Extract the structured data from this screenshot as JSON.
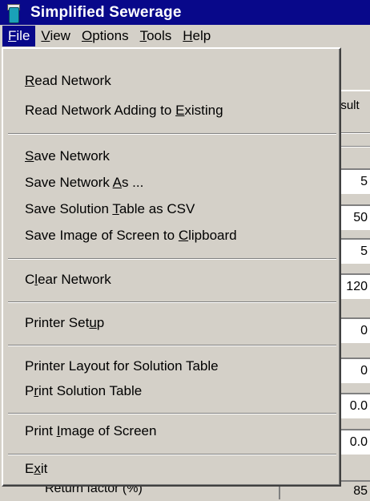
{
  "window": {
    "title": "Simplified Sewerage"
  },
  "menubar": {
    "items": [
      {
        "pre": "",
        "u": "F",
        "post": "ile"
      },
      {
        "pre": "",
        "u": "V",
        "post": "iew"
      },
      {
        "pre": "",
        "u": "O",
        "post": "ptions"
      },
      {
        "pre": "",
        "u": "T",
        "post": "ools"
      },
      {
        "pre": "",
        "u": "H",
        "post": "elp"
      }
    ]
  },
  "file_menu": {
    "items": [
      {
        "pre": "",
        "u": "R",
        "post": "ead Network"
      },
      {
        "pre": "Read Network Adding to ",
        "u": "E",
        "post": "xisting"
      },
      {
        "pre": "",
        "u": "S",
        "post": "ave Network"
      },
      {
        "pre": "Save Network ",
        "u": "A",
        "post": "s ..."
      },
      {
        "pre": "Save Solution ",
        "u": "T",
        "post": "able as CSV"
      },
      {
        "pre": "Save Image of Screen to ",
        "u": "C",
        "post": "lipboard"
      },
      {
        "pre": "C",
        "u": "l",
        "post": "ear Network"
      },
      {
        "pre": "Printer Set",
        "u": "u",
        "post": "p"
      },
      {
        "pre": "Printer Layout for Solution Table",
        "u": "",
        "post": ""
      },
      {
        "pre": "P",
        "u": "r",
        "post": "int Solution Table"
      },
      {
        "pre": "Print ",
        "u": "I",
        "post": "mage of Screen"
      },
      {
        "pre": "E",
        "u": "x",
        "post": "it"
      }
    ]
  },
  "background": {
    "tab_label": "esult",
    "fields": [
      "5",
      "50",
      "5",
      "120",
      "0",
      "0",
      "0.0",
      "0.0"
    ],
    "bottom_label": "Return factor (%)",
    "bottom_value": "85"
  }
}
